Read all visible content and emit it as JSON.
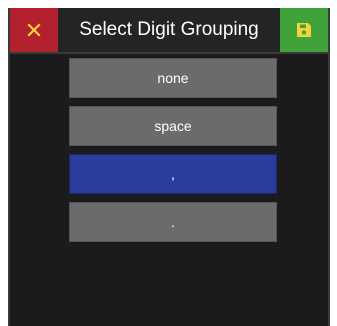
{
  "dialog": {
    "title": "Select Digit Grouping",
    "cancel_icon": "close-icon",
    "save_icon": "floppy-disk-icon"
  },
  "options": [
    {
      "label": "none",
      "selected": false
    },
    {
      "label": "space",
      "selected": false
    },
    {
      "label": ",",
      "selected": true
    },
    {
      "label": ".",
      "selected": false
    }
  ],
  "colors": {
    "cancel": "#b3202e",
    "save": "#3fa33a",
    "selected": "#2a3c9e",
    "option": "#6b6b6b",
    "background": "#1b1b1b"
  }
}
